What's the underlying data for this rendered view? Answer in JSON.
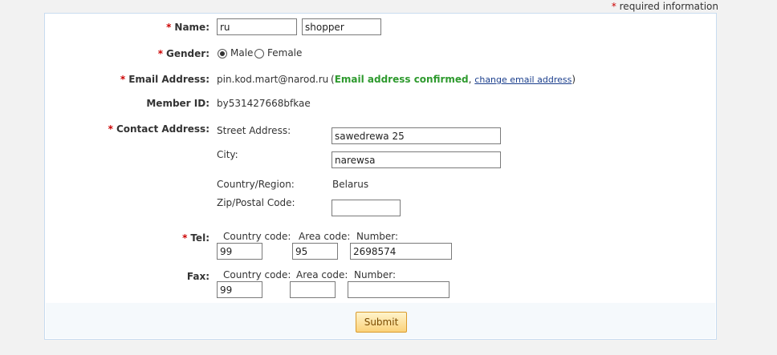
{
  "required_note": {
    "star": "*",
    "text": "required information"
  },
  "name": {
    "label": "Name:",
    "first": "ru",
    "last": "shopper"
  },
  "gender": {
    "label": "Gender:",
    "male": "Male",
    "female": "Female",
    "selected": "Male"
  },
  "email": {
    "label": "Email Address:",
    "value": "pin.kod.mart@narod.ru",
    "open_paren": "(",
    "confirmed": "Email address confirmed",
    "comma": ",",
    "change_link": "change email address",
    "close_paren": ")"
  },
  "member_id": {
    "label": "Member ID:",
    "value": "by531427668bfkae"
  },
  "contact": {
    "label": "Contact Address:",
    "street_label": "Street Address:",
    "street": "sawedrewa 25",
    "city_label": "City:",
    "city": "narewsa",
    "country_label": "Country/Region:",
    "country": "Belarus",
    "zip_label": "Zip/Postal Code:",
    "zip": ""
  },
  "tel": {
    "label": "Tel:",
    "country_code_label": "Country code:",
    "area_code_label": "Area code:",
    "number_label": "Number:",
    "country_code": "99",
    "area_code": "95",
    "number": "2698574"
  },
  "fax": {
    "label": "Fax:",
    "country_code_label": "Country code:",
    "area_code_label": "Area code:",
    "number_label": "Number:",
    "country_code": "99",
    "area_code": "",
    "number": ""
  },
  "submit_label": "Submit",
  "colors": {
    "required_star": "#cc0000",
    "confirmed": "#2e9a2e",
    "link": "#1a3e8c",
    "button": "#fbd27a"
  }
}
